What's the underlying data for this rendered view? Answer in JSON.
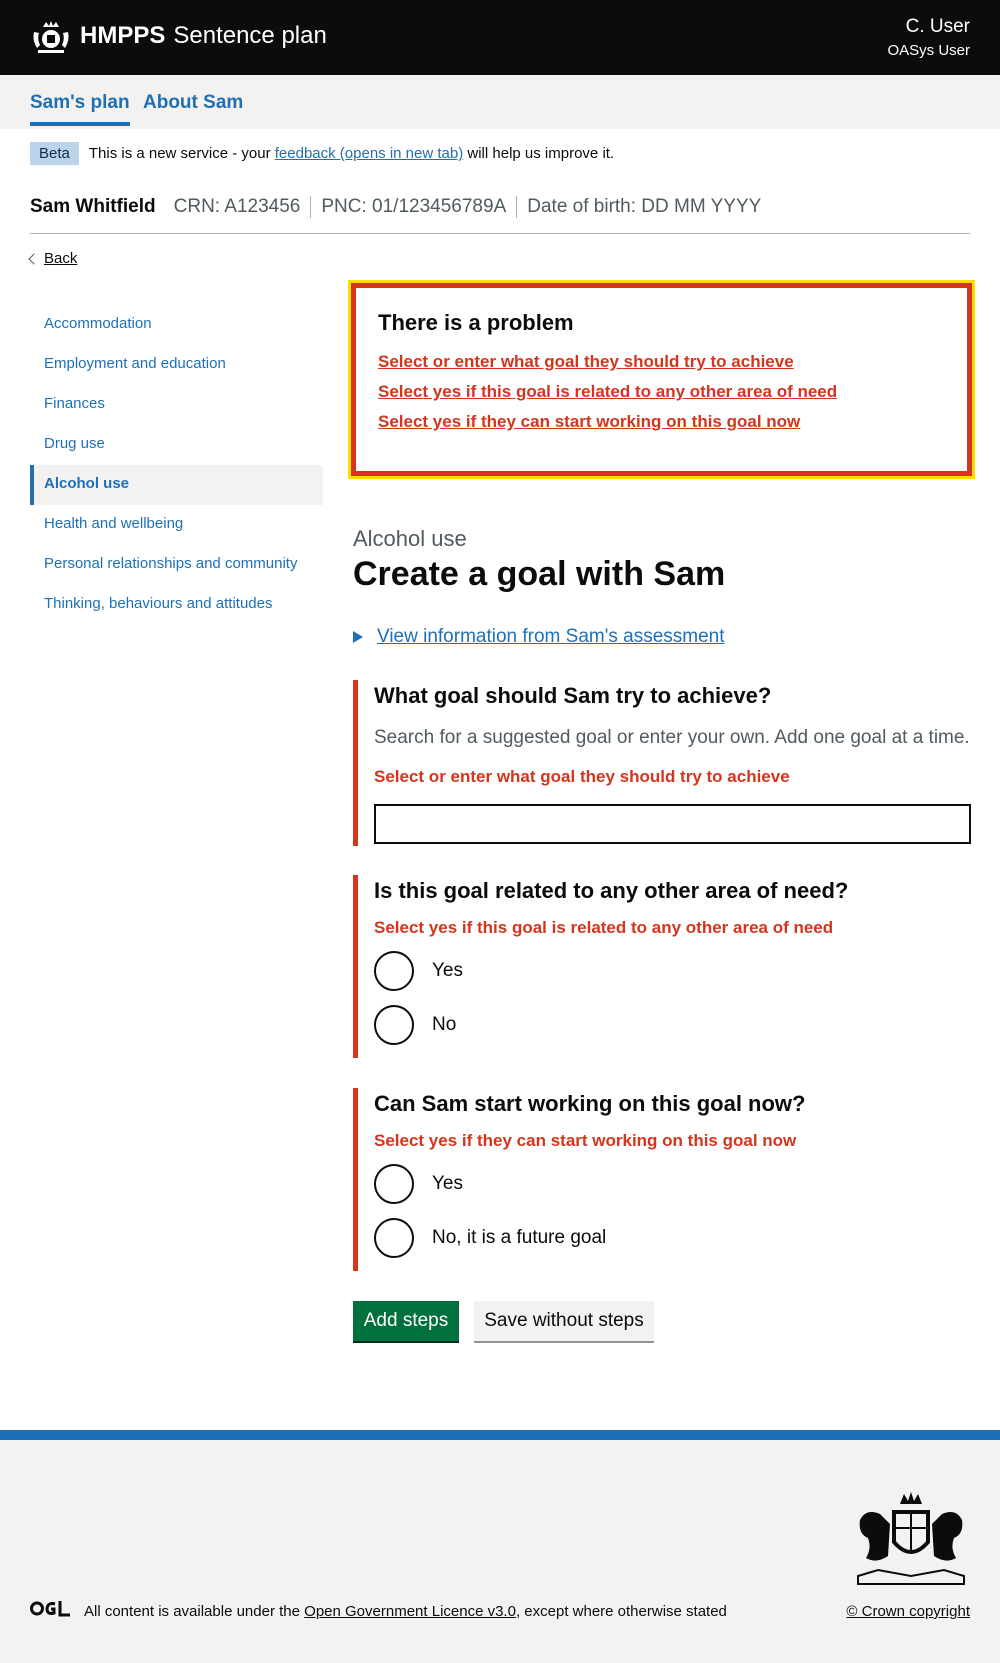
{
  "header": {
    "org": "HMPPS",
    "service": "Sentence plan",
    "user_name": "C. User",
    "user_role": "OASys User"
  },
  "nav": {
    "items": [
      {
        "label": "Sam's plan",
        "active": true
      },
      {
        "label": "About Sam",
        "active": false
      }
    ]
  },
  "phase_banner": {
    "tag": "Beta",
    "text_before": "This is a new service - your",
    "link": "feedback (opens in new tab)",
    "text_after": "will help us improve it."
  },
  "case": {
    "name": "Sam Whitfield",
    "crn": "CRN:  A123456",
    "pnc": "PNC:  01/123456789A",
    "dob": "Date of birth:  DD MM YYYY"
  },
  "back_label": "Back",
  "sidebar": {
    "items": [
      {
        "label": "Accommodation",
        "active": false
      },
      {
        "label": "Employment and education",
        "active": false
      },
      {
        "label": "Finances",
        "active": false
      },
      {
        "label": "Drug use",
        "active": false
      },
      {
        "label": "Alcohol use",
        "active": true
      },
      {
        "label": "Health and wellbeing",
        "active": false
      },
      {
        "label": "Personal relationships and community",
        "active": false
      },
      {
        "label": "Thinking, behaviours and attitudes",
        "active": false
      }
    ]
  },
  "error_summary": {
    "title": "There is a problem",
    "errors": [
      "Select or enter what goal they should try to achieve",
      "Select yes if this goal is related to any other area of need",
      "Select yes if they can start working on this goal now"
    ]
  },
  "main": {
    "caption": "Alcohol use",
    "title": "Create a goal with Sam",
    "details_summary": "View information from Sam's assessment"
  },
  "questions": {
    "goal": {
      "label": "What goal should Sam try to achieve?",
      "hint": "Search for a suggested goal or enter your own. Add one goal at a time.",
      "error": "Select or enter what goal they should try to achieve",
      "value": ""
    },
    "related": {
      "label": "Is this goal related to any other area of need?",
      "error": "Select yes if this goal is related to any other area of need",
      "options": [
        "Yes",
        "No"
      ]
    },
    "start": {
      "label": "Can Sam start working on this goal now?",
      "error": "Select yes if they can start working on this goal now",
      "options": [
        "Yes",
        "No, it is a future goal"
      ]
    }
  },
  "buttons": {
    "primary": "Add steps",
    "secondary": "Save without steps"
  },
  "footer": {
    "licence_before": "All content is available under the",
    "licence_link": "Open Government Licence v3.0",
    "licence_after": ", except where otherwise stated",
    "copyright": "© Crown copyright"
  },
  "colors": {
    "header": "#0b0c0c",
    "link": "#1d70b8",
    "error": "#d4351c",
    "focus": "#ffdd00",
    "primary_button": "#00703c",
    "footer_rule": "#1d70b8"
  }
}
